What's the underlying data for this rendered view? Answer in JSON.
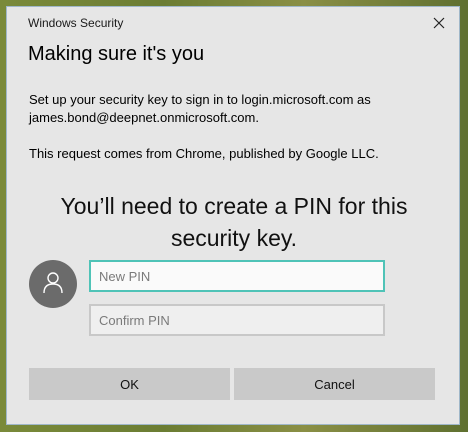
{
  "window": {
    "title": "Windows Security",
    "close_icon": "close-icon"
  },
  "dialog": {
    "heading": "Making sure it's you",
    "description_line": "Set up your security key to sign in to login.microsoft.com as james.bond@deepnet.onmicrosoft.com.",
    "source_line": "This request comes from Chrome, published by Google LLC.",
    "prompt": "You’ll need to create a PIN for this security key.",
    "avatar_icon": "user-icon"
  },
  "form": {
    "new_pin": {
      "placeholder": "New PIN",
      "value": ""
    },
    "confirm_pin": {
      "placeholder": "Confirm PIN",
      "value": ""
    }
  },
  "buttons": {
    "ok_label": "OK",
    "cancel_label": "Cancel"
  },
  "colors": {
    "focus_border": "#4fc3b7",
    "dialog_bg": "#e6e6e6",
    "button_bg": "#c9c9c9",
    "avatar_bg": "#6b6b6b"
  }
}
